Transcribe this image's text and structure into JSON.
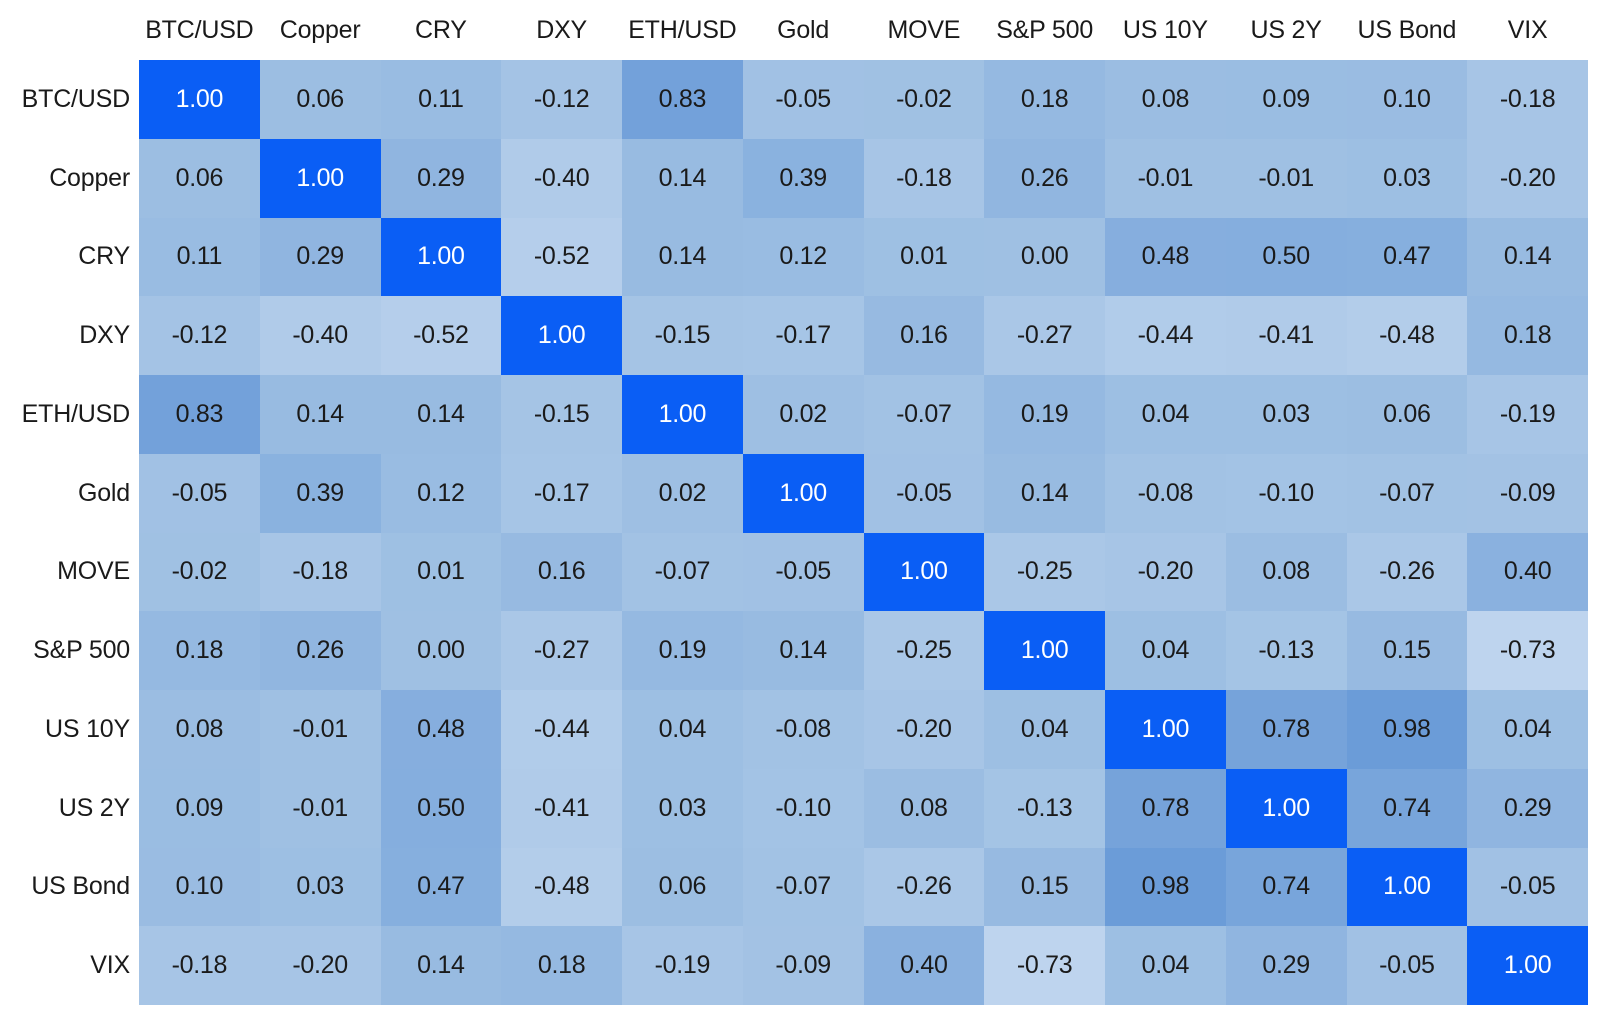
{
  "chart_data": {
    "type": "heatmap",
    "title": "",
    "subtitle": "",
    "xlabel": "",
    "ylabel": "",
    "grid": false,
    "legend": "none",
    "value_range": [
      -1,
      1
    ],
    "value_format": "2-decimal",
    "categories": [
      "BTC/USD",
      "Copper",
      "CRY",
      "DXY",
      "ETH/USD",
      "Gold",
      "MOVE",
      "S&P 500",
      "US 10Y",
      "US 2Y",
      "US Bond",
      "VIX"
    ],
    "x_tick_labels": [
      "BTC/USD",
      "Copper",
      "CRY",
      "DXY",
      "ETH/USD",
      "Gold",
      "MOVE",
      "S&P 500",
      "US 10Y",
      "US 2Y",
      "US Bond",
      "VIX"
    ],
    "y_tick_labels": [
      "BTC/USD",
      "Copper",
      "CRY",
      "DXY",
      "ETH/USD",
      "Gold",
      "MOVE",
      "S&P 500",
      "US 10Y",
      "US 2Y",
      "US Bond",
      "VIX"
    ],
    "rows": [
      {
        "label": "BTC/USD",
        "values": [
          1.0,
          0.06,
          0.11,
          -0.12,
          0.83,
          -0.05,
          -0.02,
          0.18,
          0.08,
          0.09,
          0.1,
          -0.18
        ]
      },
      {
        "label": "Copper",
        "values": [
          0.06,
          1.0,
          0.29,
          -0.4,
          0.14,
          0.39,
          -0.18,
          0.26,
          -0.01,
          -0.01,
          0.03,
          -0.2
        ]
      },
      {
        "label": "CRY",
        "values": [
          0.11,
          0.29,
          1.0,
          -0.52,
          0.14,
          0.12,
          0.01,
          0.0,
          0.48,
          0.5,
          0.47,
          0.14
        ]
      },
      {
        "label": "DXY",
        "values": [
          -0.12,
          -0.4,
          -0.52,
          1.0,
          -0.15,
          -0.17,
          0.16,
          -0.27,
          -0.44,
          -0.41,
          -0.48,
          0.18
        ]
      },
      {
        "label": "ETH/USD",
        "values": [
          0.83,
          0.14,
          0.14,
          -0.15,
          1.0,
          0.02,
          -0.07,
          0.19,
          0.04,
          0.03,
          0.06,
          -0.19
        ]
      },
      {
        "label": "Gold",
        "values": [
          -0.05,
          0.39,
          0.12,
          -0.17,
          0.02,
          1.0,
          -0.05,
          0.14,
          -0.08,
          -0.1,
          -0.07,
          -0.09
        ]
      },
      {
        "label": "MOVE",
        "values": [
          -0.02,
          -0.18,
          0.01,
          0.16,
          -0.07,
          -0.05,
          1.0,
          -0.25,
          -0.2,
          0.08,
          -0.26,
          0.4
        ]
      },
      {
        "label": "S&P 500",
        "values": [
          0.18,
          0.26,
          0.0,
          -0.27,
          0.19,
          0.14,
          -0.25,
          1.0,
          0.04,
          -0.13,
          0.15,
          -0.73
        ]
      },
      {
        "label": "US 10Y",
        "values": [
          0.08,
          -0.01,
          0.48,
          -0.44,
          0.04,
          -0.08,
          -0.2,
          0.04,
          1.0,
          0.78,
          0.98,
          0.04
        ]
      },
      {
        "label": "US 2Y",
        "values": [
          0.09,
          -0.01,
          0.5,
          -0.41,
          0.03,
          -0.1,
          0.08,
          -0.13,
          0.78,
          1.0,
          0.74,
          0.29
        ]
      },
      {
        "label": "US Bond",
        "values": [
          0.1,
          0.03,
          0.47,
          -0.48,
          0.06,
          -0.07,
          -0.26,
          0.15,
          0.98,
          0.74,
          1.0,
          -0.05
        ]
      },
      {
        "label": "VIX",
        "values": [
          -0.18,
          -0.2,
          0.14,
          0.18,
          -0.19,
          -0.09,
          0.4,
          -0.73,
          0.04,
          0.29,
          -0.05,
          1.0
        ]
      }
    ],
    "cell_text": [
      [
        "1.00",
        "0.06",
        "0.11",
        "-0.12",
        "0.83",
        "-0.05",
        "-0.02",
        "0.18",
        "0.08",
        "0.09",
        "0.10",
        "-0.18"
      ],
      [
        "0.06",
        "1.00",
        "0.29",
        "-0.40",
        "0.14",
        "0.39",
        "-0.18",
        "0.26",
        "-0.01",
        "-0.01",
        "0.03",
        "-0.20"
      ],
      [
        "0.11",
        "0.29",
        "1.00",
        "-0.52",
        "0.14",
        "0.12",
        "0.01",
        "0.00",
        "0.48",
        "0.50",
        "0.47",
        "0.14"
      ],
      [
        "-0.12",
        "-0.40",
        "-0.52",
        "1.00",
        "-0.15",
        "-0.17",
        "0.16",
        "-0.27",
        "-0.44",
        "-0.41",
        "-0.48",
        "0.18"
      ],
      [
        "0.83",
        "0.14",
        "0.14",
        "-0.15",
        "1.00",
        "0.02",
        "-0.07",
        "0.19",
        "0.04",
        "0.03",
        "0.06",
        "-0.19"
      ],
      [
        "-0.05",
        "0.39",
        "0.12",
        "-0.17",
        "0.02",
        "1.00",
        "-0.05",
        "0.14",
        "-0.08",
        "-0.10",
        "-0.07",
        "-0.09"
      ],
      [
        "-0.02",
        "-0.18",
        "0.01",
        "0.16",
        "-0.07",
        "-0.05",
        "1.00",
        "-0.25",
        "-0.20",
        "0.08",
        "-0.26",
        "0.40"
      ],
      [
        "0.18",
        "0.26",
        "0.00",
        "-0.27",
        "0.19",
        "0.14",
        "-0.25",
        "1.00",
        "0.04",
        "-0.13",
        "0.15",
        "-0.73"
      ],
      [
        "0.08",
        "-0.01",
        "0.48",
        "-0.44",
        "0.04",
        "-0.08",
        "-0.20",
        "0.04",
        "1.00",
        "0.78",
        "0.98",
        "0.04"
      ],
      [
        "0.09",
        "-0.01",
        "0.50",
        "-0.41",
        "0.03",
        "-0.10",
        "0.08",
        "-0.13",
        "0.78",
        "1.00",
        "0.74",
        "0.29"
      ],
      [
        "0.10",
        "0.03",
        "0.47",
        "-0.48",
        "0.06",
        "-0.07",
        "-0.26",
        "0.15",
        "0.98",
        "0.74",
        "1.00",
        "-0.05"
      ],
      [
        "-0.18",
        "-0.20",
        "0.14",
        "0.18",
        "-0.19",
        "-0.09",
        "0.40",
        "-0.73",
        "0.04",
        "0.29",
        "-0.05",
        "1.00"
      ]
    ],
    "colors": {
      "diagonal": "#0a5ef5",
      "high": "#6a9bd8",
      "mid": "#9fc0e3",
      "low": "#c9dbf2",
      "text_dark": "#1a1a1a",
      "text_light": "#ffffff",
      "background": "#ffffff"
    }
  }
}
